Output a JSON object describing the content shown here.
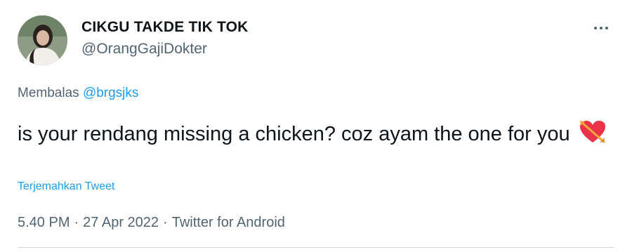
{
  "tweet": {
    "author": {
      "display_name": "CIKGU TAKDE TIK TOK",
      "handle": "@OrangGajiDokter",
      "avatar_icon": "profile-photo"
    },
    "more_icon": "ellipsis-icon",
    "reply_context": {
      "prefix": "Membalas",
      "mention": "@brgsjks"
    },
    "text": "is your rendang missing a chicken? coz ayam the one for you",
    "emoji_icon": "heart-with-arrow-icon",
    "translate_label": "Terjemahkan Tweet",
    "meta": {
      "time": "5.40 PM",
      "separator": "·",
      "date": "27 Apr 2022",
      "source": "Twitter for Android"
    }
  },
  "colors": {
    "text": "#0f1419",
    "secondary": "#536471",
    "link": "#1d9bf0",
    "divider": "#cfd9de"
  }
}
